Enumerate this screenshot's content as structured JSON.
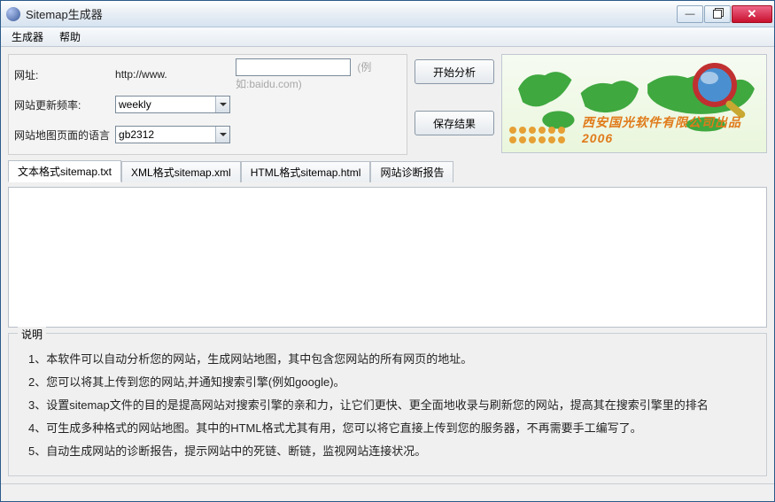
{
  "window": {
    "title": "Sitemap生成器"
  },
  "menu": {
    "generator": "生成器",
    "help": "帮助"
  },
  "form": {
    "url_label": "网址:",
    "url_prefix": "http://www.",
    "url_value": "",
    "url_hint": "(例如:baidu.com)",
    "freq_label": "网站更新频率:",
    "freq_value": "weekly",
    "lang_label": "网站地图页面的语言",
    "lang_value": "gb2312"
  },
  "buttons": {
    "analyze": "开始分析",
    "save": "保存结果"
  },
  "banner": {
    "text": "西安国光软件有限公司出品 2006"
  },
  "tabs": [
    {
      "id": "txt",
      "label": "文本格式sitemap.txt",
      "active": true
    },
    {
      "id": "xml",
      "label": "XML格式sitemap.xml",
      "active": false
    },
    {
      "id": "html",
      "label": "HTML格式sitemap.html",
      "active": false
    },
    {
      "id": "diag",
      "label": "网站诊断报告",
      "active": false
    }
  ],
  "output": "",
  "description": {
    "legend": "说明",
    "items": [
      "1、本软件可以自动分析您的网站，生成网站地图，其中包含您网站的所有网页的地址。",
      "2、您可以将其上传到您的网站,并通知搜索引擎(例如google)。",
      "3、设置sitemap文件的目的是提高网站对搜索引擎的亲和力，让它们更快、更全面地收录与刷新您的网站，提高其在搜索引擎里的排名",
      "4、可生成多种格式的网站地图。其中的HTML格式尤其有用，您可以将它直接上传到您的服务器，不再需要手工编写了。",
      "5、自动生成网站的诊断报告，提示网站中的死链、断链，监视网站连接状况。"
    ]
  }
}
